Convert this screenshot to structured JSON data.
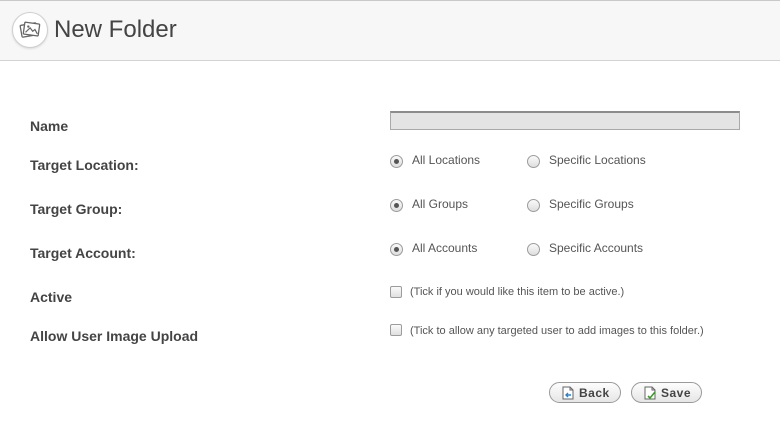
{
  "header": {
    "title": "New Folder",
    "logo_icon": "gallery-icon"
  },
  "form": {
    "name": {
      "label": "Name",
      "value": "",
      "placeholder": ""
    },
    "target_location": {
      "label": "Target Location:",
      "options": [
        "All Locations",
        "Specific Locations"
      ],
      "selected": "All Locations"
    },
    "target_group": {
      "label": "Target Group:",
      "options": [
        "All Groups",
        "Specific Groups"
      ],
      "selected": "All Groups"
    },
    "target_account": {
      "label": "Target Account:",
      "options": [
        "All Accounts",
        "Specific Accounts"
      ],
      "selected": "All Accounts"
    },
    "active": {
      "label": "Active",
      "hint": "(Tick if you would like this item to be active.)",
      "checked": false
    },
    "allow_upload": {
      "label": "Allow User Image Upload",
      "hint": "(Tick to allow any targeted user to add images to this folder.)",
      "checked": false
    }
  },
  "buttons": {
    "back": {
      "label": "Back",
      "icon": "back-page-icon"
    },
    "save": {
      "label": "Save",
      "icon": "save-page-icon"
    }
  }
}
